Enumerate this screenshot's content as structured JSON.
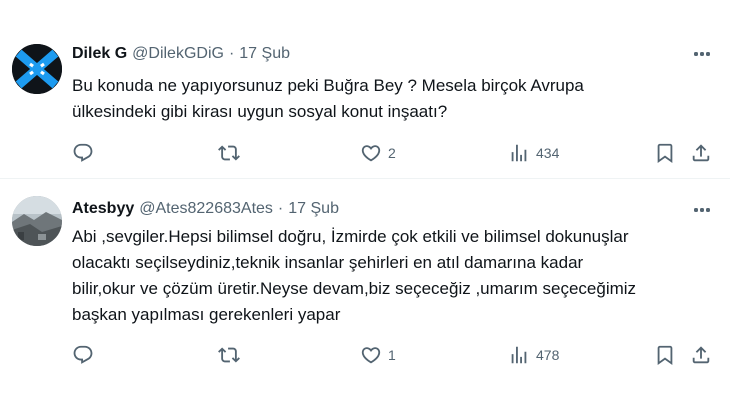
{
  "tweets": [
    {
      "name": "Dilek G",
      "handle": "@DilekGDiG",
      "separator": "·",
      "date": "17 Şub",
      "text": "Bu konuda ne yapıyorsunuz peki Buğra Bey ? Mesela birçok Avrupa\nülkesindeki gibi kirası uygun sosyal konut inşaatı?",
      "likes": "2",
      "views": "434"
    },
    {
      "name": "Atesbyy",
      "handle": "@Ates822683Ates",
      "separator": "·",
      "date": "17 Şub",
      "text": "Abi ,sevgiler.Hepsi bilimsel doğru, İzmirde çok etkili ve bilimsel dokunuşlar\nolacaktı seçilseydiniz,teknik insanlar şehirleri en atıl damarına kadar\nbilir,okur ve çözüm üretir.Neyse devam,biz seçeceğiz ,umarım seçeceğimiz\nbaşkan yapılması gerekenleri yapar",
      "likes": "1",
      "views": "478"
    }
  ],
  "icons": {
    "reply": "reply-icon",
    "retweet": "retweet-icon",
    "like": "heart-icon",
    "views": "views-icon",
    "bookmark": "bookmark-icon",
    "share": "share-icon",
    "more": "more-icon"
  },
  "colors": {
    "text_primary": "#0f1419",
    "text_secondary": "#536471",
    "divider": "#eff3f4",
    "avatar1_accent": "#1d9bf0"
  }
}
